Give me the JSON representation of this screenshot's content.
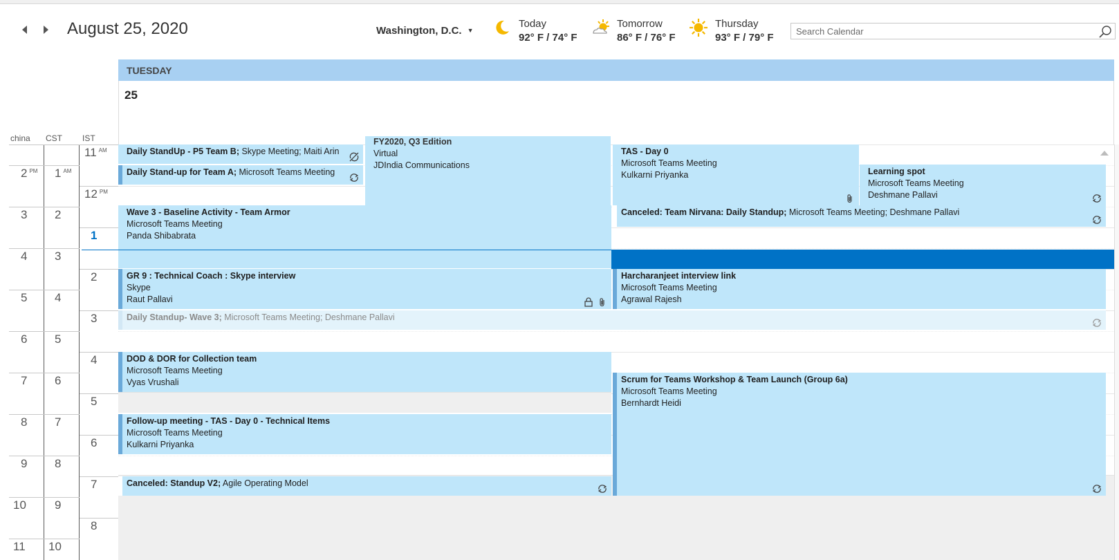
{
  "header": {
    "date_title": "August 25, 2020",
    "location": "Washington,  D.C.",
    "weather": [
      {
        "day": "Today",
        "temp": "92° F / 74° F",
        "icon": "moon-icon"
      },
      {
        "day": "Tomorrow",
        "temp": "86° F / 76° F",
        "icon": "partly-sunny-icon"
      },
      {
        "day": "Thursday",
        "temp": "93° F / 79° F",
        "icon": "sun-icon"
      }
    ],
    "search_placeholder": "Search Calendar"
  },
  "day": {
    "name": "TUESDAY",
    "number": "25"
  },
  "timezones": {
    "labels": [
      "china",
      "CST",
      "IST"
    ],
    "china": [
      "2",
      "3",
      "4",
      "5",
      "6",
      "7",
      "8",
      "9",
      "10",
      "11"
    ],
    "china_ampm": "PM",
    "cst": [
      "1",
      "2",
      "3",
      "4",
      "5",
      "6",
      "7",
      "8",
      "9",
      "10"
    ],
    "cst_ampm": "AM",
    "ist": [
      "11",
      "12",
      "1",
      "2",
      "3",
      "4",
      "5",
      "6",
      "7",
      "8"
    ],
    "ist_am": "AM",
    "ist_pm": "PM"
  },
  "events": {
    "e1": {
      "title": "Daily StandUp - P5 Team B;",
      "loc": " Skype Meeting; Maiti Arin"
    },
    "e2": {
      "title": "Daily Stand-up for Team A;",
      "loc": " Microsoft Teams Meeting"
    },
    "e3": {
      "title": "FY2020, Q3 Edition",
      "line1": "Virtual",
      "line2": "JDIndia Communications"
    },
    "e4": {
      "title": "TAS - Day 0",
      "line1": "Microsoft Teams Meeting",
      "line2": "Kulkarni Priyanka"
    },
    "e5": {
      "title": "Learning spot",
      "line1": "Microsoft Teams Meeting",
      "line2": "Deshmane Pallavi"
    },
    "e6": {
      "title": "Wave 3 - Baseline Activity - Team Armor",
      "line1": "Microsoft Teams Meeting",
      "line2": "Panda Shibabrata"
    },
    "e7": {
      "title": "Canceled: Team Nirvana: Daily Standup;",
      "loc": " Microsoft Teams Meeting; Deshmane Pallavi"
    },
    "e8": {
      "title": "GR 9 : Technical Coach : Skype interview",
      "line1": "Skype",
      "line2": "Raut Pallavi"
    },
    "e9": {
      "title": "Harcharanjeet interview link",
      "line1": "Microsoft Teams Meeting",
      "line2": "Agrawal Rajesh"
    },
    "e10": {
      "title": "Daily Standup- Wave 3;",
      "loc": " Microsoft Teams Meeting; Deshmane Pallavi"
    },
    "e11": {
      "title": "DOD & DOR for Collection team",
      "line1": "Microsoft Teams Meeting",
      "line2": "Vyas Vrushali"
    },
    "e12": {
      "title": "Scrum for Teams Workshop & Team Launch (Group 6a)",
      "line1": "Microsoft Teams Meeting",
      "line2": "Bernhardt Heidi"
    },
    "e13": {
      "title": "Follow-up meeting - TAS - Day 0 - Technical Items",
      "line1": "Microsoft Teams Meeting",
      "line2": "Kulkarni Priyanka"
    },
    "e14": {
      "title": "Canceled: Standup V2;",
      "loc": " Agile Operating Model"
    }
  },
  "colors": {
    "accent": "#0072c6",
    "event_bg": "#bfe6fa",
    "day_header": "#a8d0f2",
    "offhours": "#efefef"
  }
}
